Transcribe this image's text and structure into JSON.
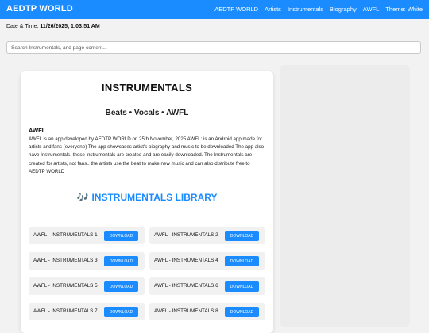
{
  "nav": {
    "brand": "AEDTP WORLD",
    "links": [
      "AEDTP WORLD",
      "Artists",
      "Instrumentals",
      "Biography",
      "AWFL",
      "Theme: White"
    ]
  },
  "datetime": {
    "label": "Date & Time:",
    "value": "11/26/2025, 1:03:51 AM"
  },
  "search": {
    "placeholder": "Search Instrumentals, and page content..."
  },
  "main": {
    "title": "INSTRUMENTALS",
    "subtitle": "Beats • Vocals • AWFL",
    "about_heading": "AWFL",
    "about_text": "AWFL is an app developed by AEDTP WORLD on 25th November, 2025 AWFL: is an Android app made for artists and fans (everyone) The app showcases artist's biography and music to be downloaded The app also have Instrumentals, these instrumentals are created and are easily downloaded. The Instrumentals are created for artists, not fans.. the artists use the beat to make new music and can also distribute free to AEDTP WORLD",
    "library_icon": "🎶",
    "library_title": "INSTRUMENTALS LIBRARY",
    "tracks": [
      {
        "label": "AWFL - INSTRUMENTALS 1",
        "button": "DOWNLOAD"
      },
      {
        "label": "AWFL - INSTRUMENTALS 2",
        "button": "DOWNLOAD"
      },
      {
        "label": "AWFL - INSTRUMENTALS 3",
        "button": "DOWNLOAD"
      },
      {
        "label": "AWFL - INSTRUMENTALS 4",
        "button": "DOWNLOAD"
      },
      {
        "label": "AWFL - INSTRUMENTALS 5",
        "button": "DOWNLOAD"
      },
      {
        "label": "AWFL - INSTRUMENTALS 6",
        "button": "DOWNLOAD"
      },
      {
        "label": "AWFL - INSTRUMENTALS 7",
        "button": "DOWNLOAD"
      },
      {
        "label": "AWFL - INSTRUMENTALS 8",
        "button": "DOWNLOAD"
      }
    ]
  },
  "colors": {
    "accent": "#1a8cff",
    "page_background": "#f2f2f2"
  }
}
